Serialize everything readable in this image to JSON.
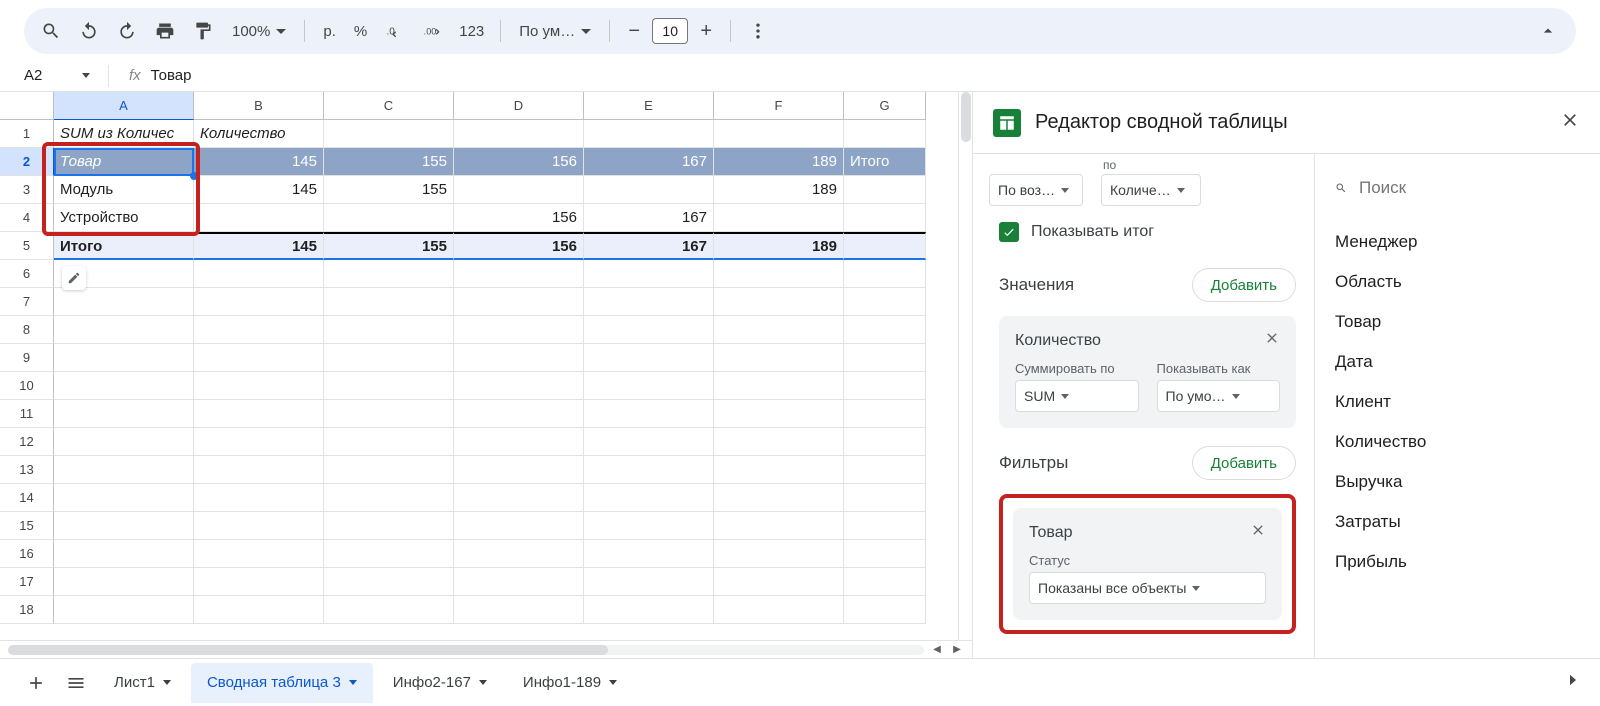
{
  "toolbar": {
    "zoom": "100%",
    "currency": "р.",
    "percent": "%",
    "num123": "123",
    "font": "По ум…",
    "fontSize": "10"
  },
  "formula": {
    "cellRef": "A2",
    "value": "Товар"
  },
  "columns": [
    "A",
    "B",
    "C",
    "D",
    "E",
    "F",
    "G"
  ],
  "rows": [
    {
      "n": "1",
      "cells": [
        "SUM из Количес",
        "Количество",
        "",
        "",
        "",
        "",
        ""
      ],
      "cls": "italic"
    },
    {
      "n": "2",
      "cells": [
        "Товар",
        "145",
        "155",
        "156",
        "167",
        "189",
        "Итого"
      ],
      "cls": "blue",
      "italicFirst": true
    },
    {
      "n": "3",
      "cells": [
        "Модуль",
        "145",
        "155",
        "",
        "",
        "189",
        ""
      ]
    },
    {
      "n": "4",
      "cells": [
        "Устройство",
        "",
        "",
        "156",
        "167",
        "",
        ""
      ]
    },
    {
      "n": "5",
      "cells": [
        "Итого",
        "145",
        "155",
        "156",
        "167",
        "189",
        ""
      ],
      "cls": "total"
    },
    {
      "n": "6",
      "cells": [
        "",
        "",
        "",
        "",
        "",
        "",
        ""
      ]
    },
    {
      "n": "7",
      "cells": [
        "",
        "",
        "",
        "",
        "",
        "",
        ""
      ]
    },
    {
      "n": "8",
      "cells": [
        "",
        "",
        "",
        "",
        "",
        "",
        ""
      ]
    },
    {
      "n": "9",
      "cells": [
        "",
        "",
        "",
        "",
        "",
        "",
        ""
      ]
    },
    {
      "n": "10",
      "cells": [
        "",
        "",
        "",
        "",
        "",
        "",
        ""
      ]
    },
    {
      "n": "11",
      "cells": [
        "",
        "",
        "",
        "",
        "",
        "",
        ""
      ]
    },
    {
      "n": "12",
      "cells": [
        "",
        "",
        "",
        "",
        "",
        "",
        ""
      ]
    },
    {
      "n": "13",
      "cells": [
        "",
        "",
        "",
        "",
        "",
        "",
        ""
      ]
    },
    {
      "n": "14",
      "cells": [
        "",
        "",
        "",
        "",
        "",
        "",
        ""
      ]
    },
    {
      "n": "15",
      "cells": [
        "",
        "",
        "",
        "",
        "",
        "",
        ""
      ]
    },
    {
      "n": "16",
      "cells": [
        "",
        "",
        "",
        "",
        "",
        "",
        ""
      ]
    },
    {
      "n": "17",
      "cells": [
        "",
        "",
        "",
        "",
        "",
        "",
        ""
      ]
    },
    {
      "n": "18",
      "cells": [
        "",
        "",
        "",
        "",
        "",
        "",
        ""
      ]
    }
  ],
  "panel": {
    "title": "Редактор сводной таблицы",
    "sortAsc": "По воз…",
    "sortByLabel": "по",
    "sortBy": "Количе…",
    "showTotal": "Показывать итог",
    "valuesTitle": "Значения",
    "addBtn": "Добавить",
    "valCard": {
      "name": "Количество",
      "sumLabel": "Суммировать по",
      "sumVal": "SUM",
      "showAsLabel": "Показывать как",
      "showAsVal": "По умо…"
    },
    "filtersTitle": "Фильтры",
    "filterCard": {
      "name": "Товар",
      "statusLabel": "Статус",
      "statusVal": "Показаны все объекты"
    },
    "searchPlaceholder": "Поиск",
    "fields": [
      "Менеджер",
      "Область",
      "Товар",
      "Дата",
      "Клиент",
      "Количество",
      "Выручка",
      "Затраты",
      "Прибыль"
    ]
  },
  "tabs": {
    "items": [
      {
        "label": "Лист1",
        "active": false
      },
      {
        "label": "Сводная таблица 3",
        "active": true
      },
      {
        "label": "Инфо2-167",
        "active": false
      },
      {
        "label": "Инфо1-189",
        "active": false
      }
    ]
  }
}
